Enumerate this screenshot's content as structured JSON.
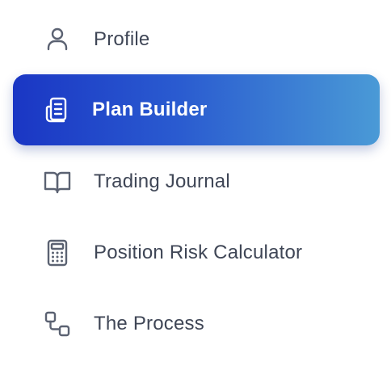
{
  "nav": {
    "items": [
      {
        "label": "Profile",
        "icon": "user-icon",
        "active": false
      },
      {
        "label": "Plan Builder",
        "icon": "clipboard-icon",
        "active": true
      },
      {
        "label": "Trading Journal",
        "icon": "book-open-icon",
        "active": false
      },
      {
        "label": "Position Risk Calculator",
        "icon": "calculator-icon",
        "active": false
      },
      {
        "label": "The Process",
        "icon": "process-icon",
        "active": false
      }
    ]
  },
  "colors": {
    "text": "#3f4656",
    "active_text": "#ffffff",
    "active_gradient_start": "#1a36c4",
    "active_gradient_end": "#4a9ad6",
    "icon": "#5b6272"
  }
}
